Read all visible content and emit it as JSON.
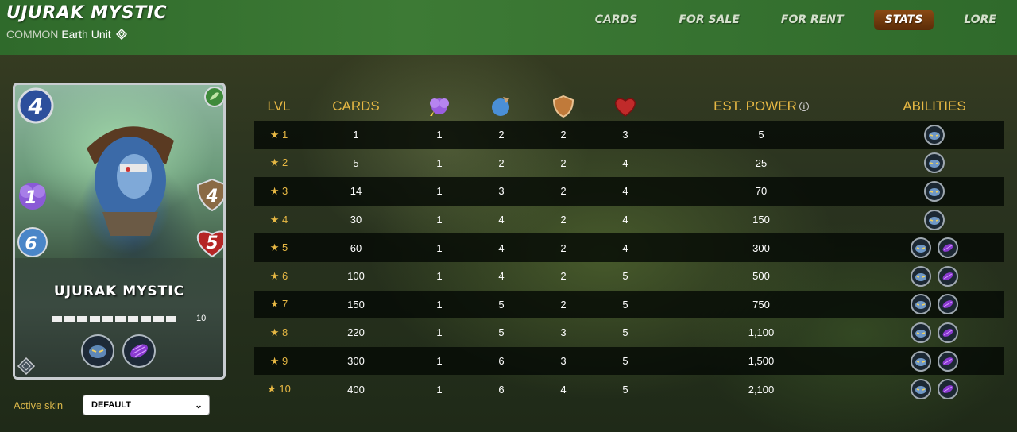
{
  "header": {
    "title": "UJURAK MYSTIC",
    "rarity": "COMMON",
    "element": "Earth",
    "type": "Unit",
    "nav": [
      {
        "label": "CARDS",
        "active": false
      },
      {
        "label": "FOR SALE",
        "active": false
      },
      {
        "label": "FOR RENT",
        "active": false
      },
      {
        "label": "STATS",
        "active": true
      },
      {
        "label": "LORE",
        "active": false
      }
    ]
  },
  "card": {
    "name": "UJURAK MYSTIC",
    "mana": "4",
    "magic": "1",
    "speed": "6",
    "armor": "4",
    "health": "5",
    "level": "10",
    "level_pips": 10,
    "abilities": [
      "demoralize-icon",
      "affliction-icon"
    ]
  },
  "skin": {
    "label": "Active skin",
    "value": "DEFAULT"
  },
  "table": {
    "headers": {
      "lvl": "LVL",
      "cards": "CARDS",
      "magic": "magic-icon",
      "speed": "speed-icon",
      "armor": "armor-icon",
      "health": "health-icon",
      "power": "EST. POWER",
      "abilities": "ABILITIES"
    },
    "rows": [
      {
        "lvl": "★ 1",
        "cards": "1",
        "magic": "1",
        "speed": "2",
        "armor": "2",
        "health": "3",
        "power": "5",
        "abilities": 1
      },
      {
        "lvl": "★ 2",
        "cards": "5",
        "magic": "1",
        "speed": "2",
        "armor": "2",
        "health": "4",
        "power": "25",
        "abilities": 1
      },
      {
        "lvl": "★ 3",
        "cards": "14",
        "magic": "1",
        "speed": "3",
        "armor": "2",
        "health": "4",
        "power": "70",
        "abilities": 1
      },
      {
        "lvl": "★ 4",
        "cards": "30",
        "magic": "1",
        "speed": "4",
        "armor": "2",
        "health": "4",
        "power": "150",
        "abilities": 1
      },
      {
        "lvl": "★ 5",
        "cards": "60",
        "magic": "1",
        "speed": "4",
        "armor": "2",
        "health": "4",
        "power": "300",
        "abilities": 2
      },
      {
        "lvl": "★ 6",
        "cards": "100",
        "magic": "1",
        "speed": "4",
        "armor": "2",
        "health": "5",
        "power": "500",
        "abilities": 2
      },
      {
        "lvl": "★ 7",
        "cards": "150",
        "magic": "1",
        "speed": "5",
        "armor": "2",
        "health": "5",
        "power": "750",
        "abilities": 2
      },
      {
        "lvl": "★ 8",
        "cards": "220",
        "magic": "1",
        "speed": "5",
        "armor": "3",
        "health": "5",
        "power": "1,100",
        "abilities": 2
      },
      {
        "lvl": "★ 9",
        "cards": "300",
        "magic": "1",
        "speed": "6",
        "armor": "3",
        "health": "5",
        "power": "1,500",
        "abilities": 2
      },
      {
        "lvl": "★ 10",
        "cards": "400",
        "magic": "1",
        "speed": "6",
        "armor": "4",
        "health": "5",
        "power": "2,100",
        "abilities": 2
      }
    ]
  },
  "colors": {
    "accent_gold": "#e7b844",
    "header_green": "#3d7a35",
    "active_tab": "#8a4a14"
  }
}
